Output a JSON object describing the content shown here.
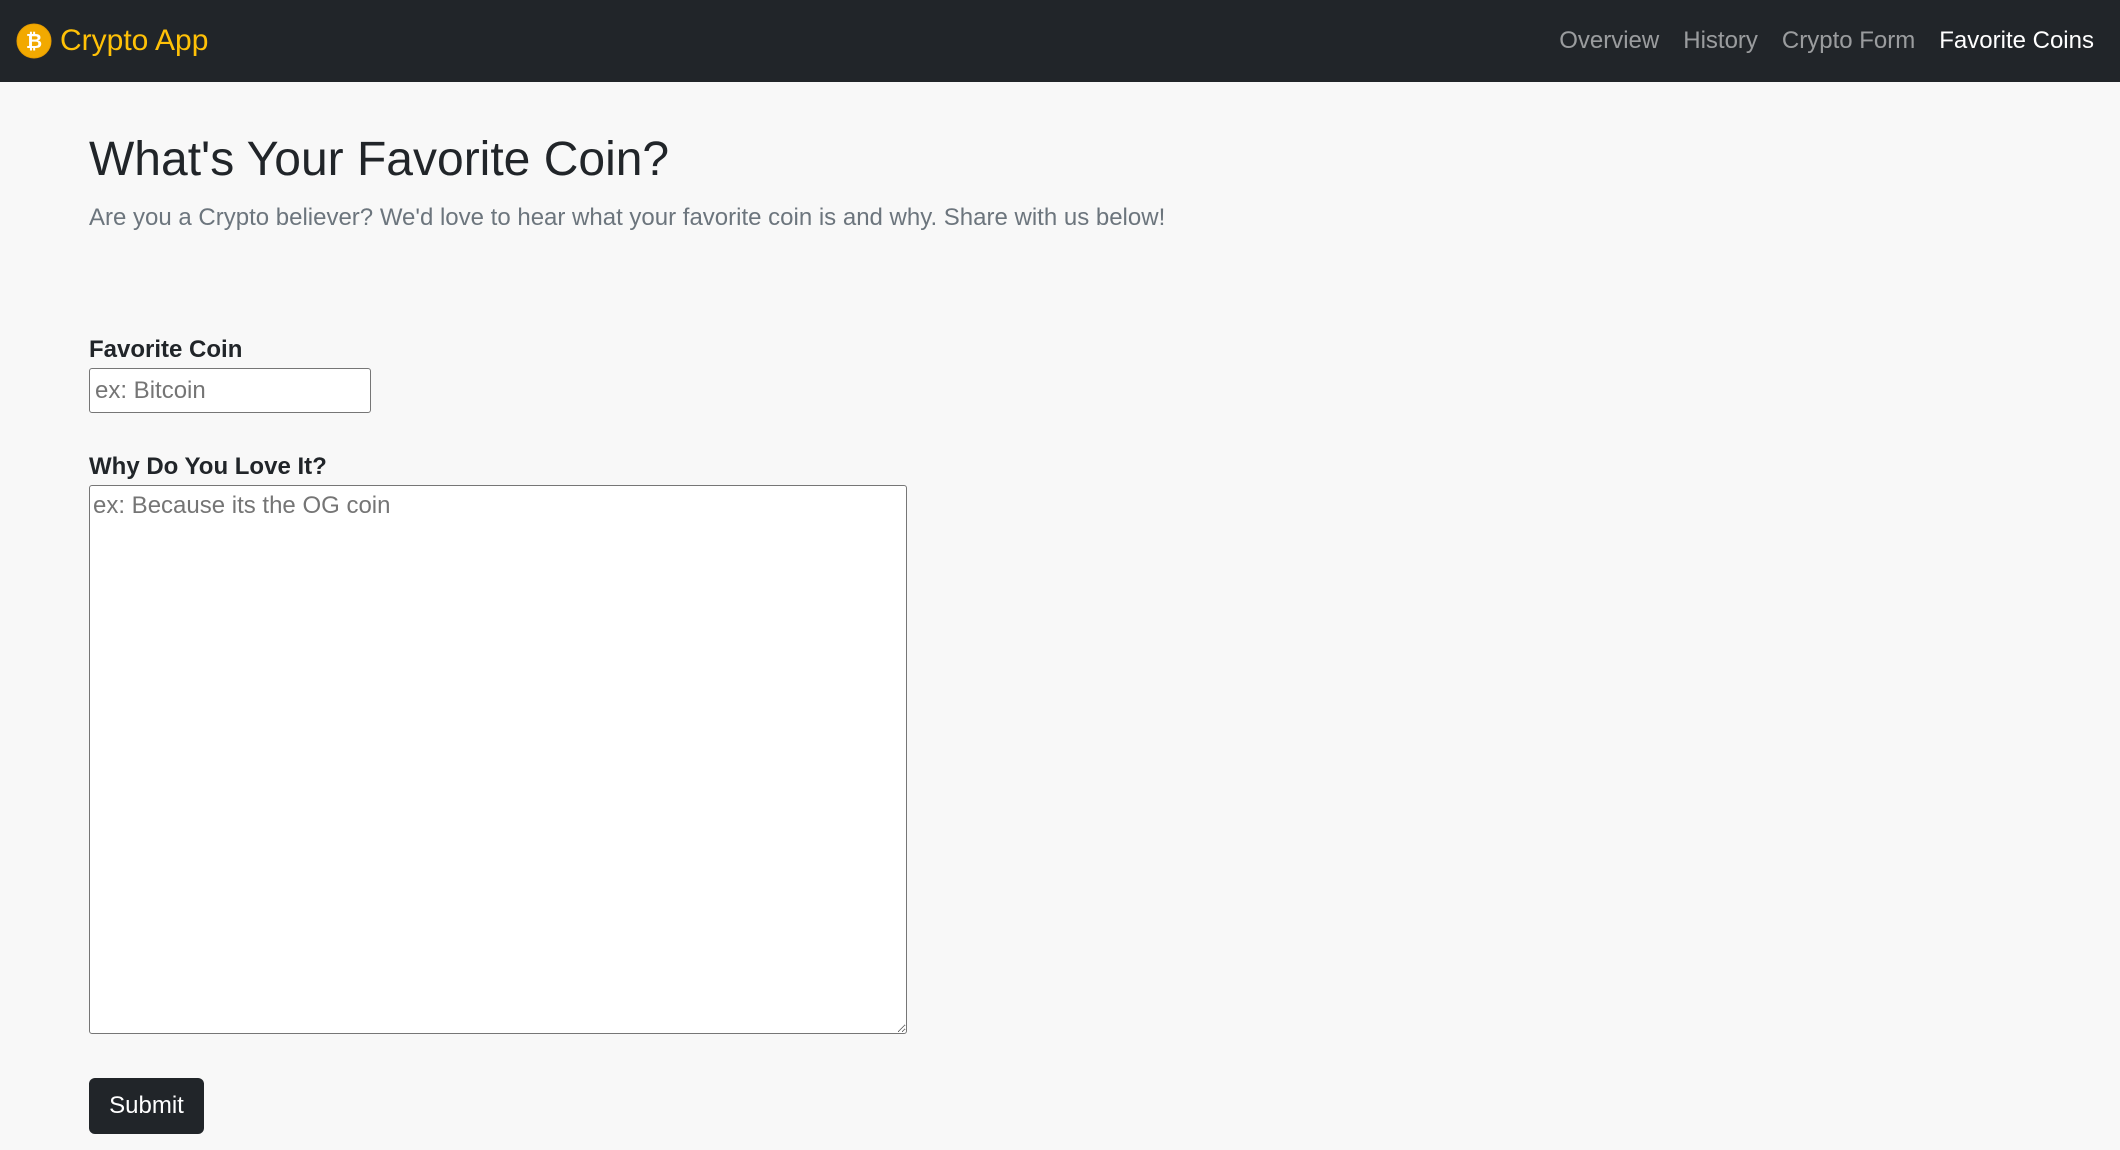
{
  "navbar": {
    "brand": {
      "icon": "bitcoin-icon",
      "label": "Crypto App",
      "color": "#ffc107"
    },
    "links": [
      {
        "label": "Overview",
        "active": false
      },
      {
        "label": "History",
        "active": false
      },
      {
        "label": "Crypto Form",
        "active": false
      },
      {
        "label": "Favorite Coins",
        "active": true
      }
    ],
    "background": "#212529"
  },
  "main": {
    "title": "What's Your Favorite Coin?",
    "subtitle": "Are you a Crypto believer? We'd love to hear what your favorite coin is and why. Share with us below!",
    "form": {
      "coin_label": "Favorite Coin",
      "coin_value": "",
      "coin_placeholder": "ex: Bitcoin",
      "why_label": "Why Do You Love It?",
      "why_value": "",
      "why_placeholder": "ex: Because its the OG coin",
      "submit_label": "Submit"
    }
  }
}
